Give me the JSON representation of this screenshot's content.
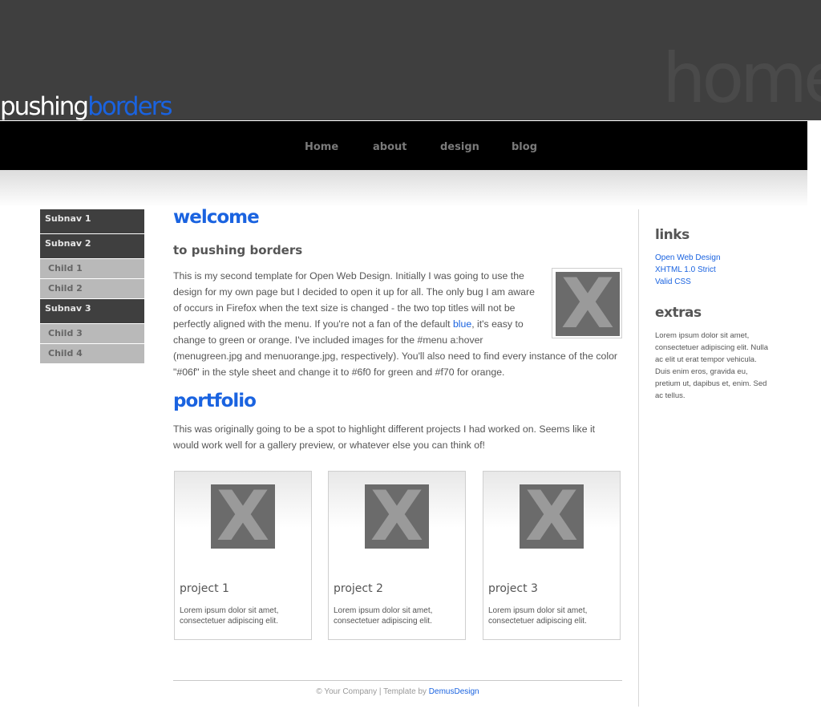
{
  "header": {
    "watermark": "home",
    "logo_part1": "pushing",
    "logo_part2": "borders",
    "accent_color": "#1a63e0",
    "background": "#3f3f3f"
  },
  "menu": {
    "items": [
      {
        "label": "Home"
      },
      {
        "label": "about"
      },
      {
        "label": "design"
      },
      {
        "label": "blog"
      }
    ]
  },
  "subnav": {
    "items": [
      {
        "label": "Subnav 1",
        "type": "parent"
      },
      {
        "label": "Subnav 2",
        "type": "parent"
      },
      {
        "label": "Child 1",
        "type": "child"
      },
      {
        "label": "Child 2",
        "type": "child"
      },
      {
        "label": "Subnav 3",
        "type": "parent"
      },
      {
        "label": "Child 3",
        "type": "child"
      },
      {
        "label": "Child 4",
        "type": "child"
      }
    ]
  },
  "main": {
    "welcome_title": "welcome",
    "welcome_subtitle": "to pushing borders",
    "intro_part1": "This is my second template for Open Web Design. Initially I was going to use the design for my own page but I decided to open it up for all. The only bug I am aware of occurs in Firefox when the text size is changed - the two top titles will not be perfectly aligned with the menu. If you're not a fan of the default ",
    "intro_link": "blue",
    "intro_part2": ", it's easy to change to green or orange. I've included images for the #menu a:hover (menugreen.jpg and menuorange.jpg, respectively). You'll also need to find every instance of the color \"#06f\" in the style sheet and change it to #6f0 for green and #f70 for orange.",
    "portfolio_title": "portfolio",
    "portfolio_text": "This was originally going to be a spot to highlight different projects I had worked on. Seems like it would work well for a gallery preview, or whatever else you can think of!",
    "image_glyph": "X"
  },
  "projects": [
    {
      "title": "project 1",
      "desc": "Lorem ipsum dolor sit amet, consectetuer adipiscing elit."
    },
    {
      "title": "project 2",
      "desc": "Lorem ipsum dolor sit amet, consectetuer adipiscing elit."
    },
    {
      "title": "project 3",
      "desc": "Lorem ipsum dolor sit amet, consectetuer adipiscing elit."
    }
  ],
  "footer": {
    "text": "© Your Company | Template by ",
    "link": "DemusDesign"
  },
  "sidebar": {
    "links_title": "links",
    "links": [
      {
        "label": "Open Web Design"
      },
      {
        "label": "XHTML 1.0 Strict"
      },
      {
        "label": "Valid CSS"
      }
    ],
    "extras_title": "extras",
    "extras_text": "Lorem ipsum dolor sit amet, consectetuer adipiscing elit. Nulla ac elit ut erat tempor vehicula. Duis enim eros, gravida eu, pretium ut, dapibus et, enim. Sed ac tellus."
  }
}
